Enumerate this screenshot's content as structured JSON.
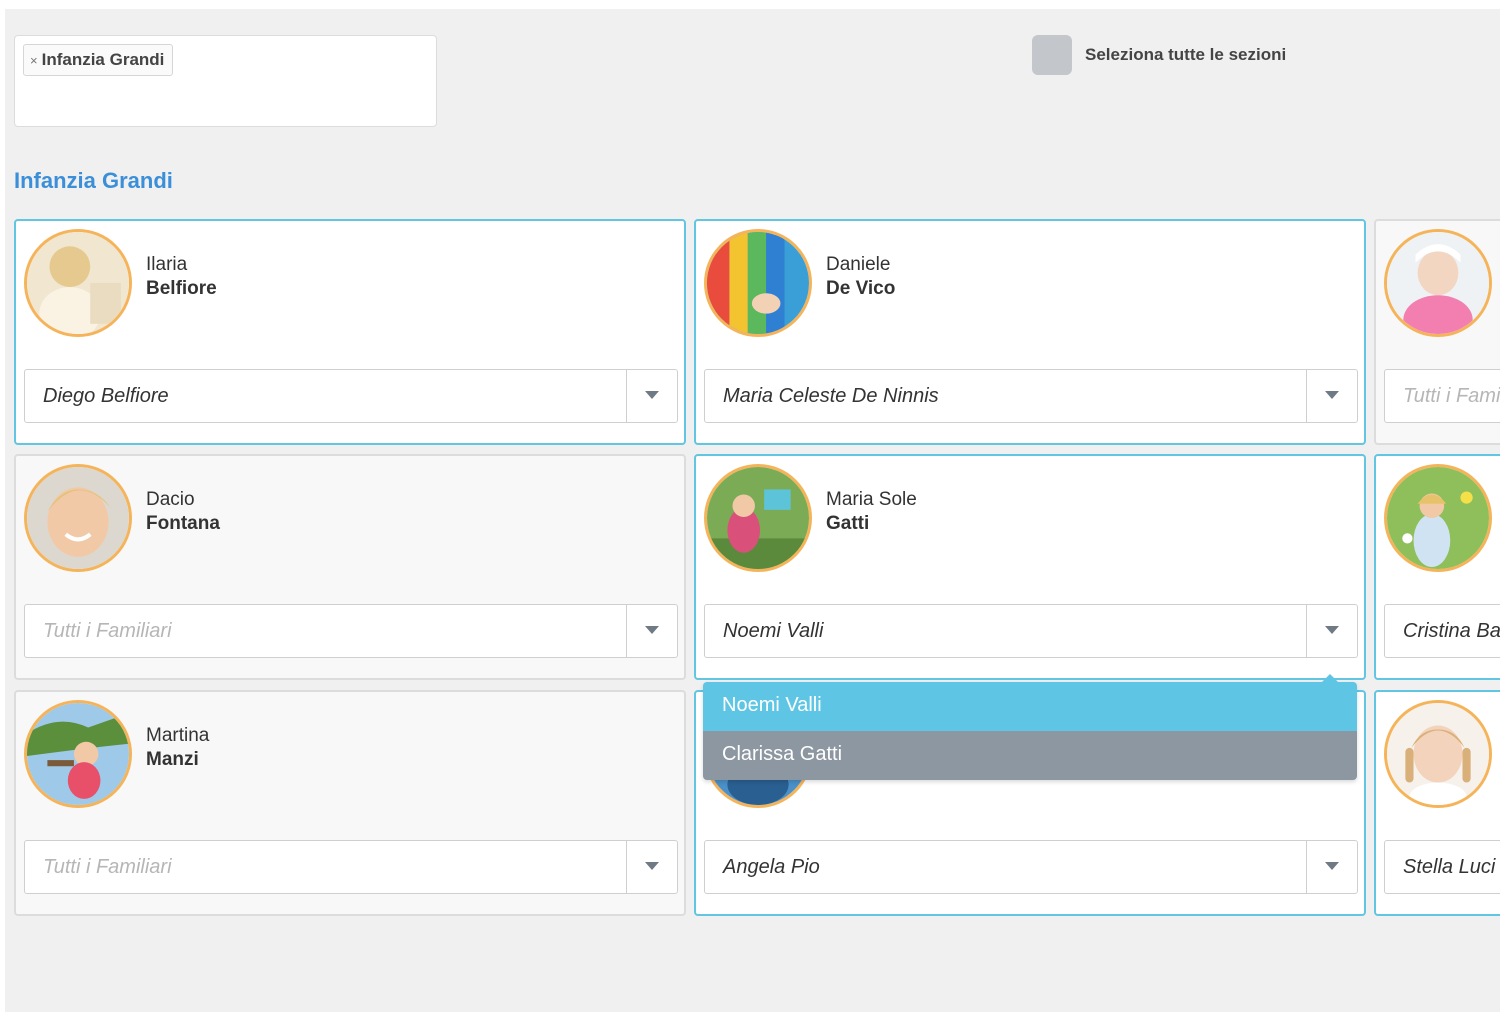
{
  "filter": {
    "remove_symbol": "×",
    "tag": "Infanzia Grandi"
  },
  "select_all_label": "Seleziona tutte le sezioni",
  "section_title": "Infanzia Grandi",
  "cards": [
    {
      "first": "Ilaria",
      "last": "Belfiore",
      "selected": "Diego Belfiore",
      "placeholder": false,
      "active": true
    },
    {
      "first": "Daniele",
      "last": "De Vico",
      "selected": "Maria Celeste De Ninnis",
      "placeholder": false,
      "active": true
    },
    {
      "first": "",
      "last": "",
      "selected": "Tutti i Familiari",
      "placeholder": true,
      "active": false
    },
    {
      "first": "Dacio",
      "last": "Fontana",
      "selected": "Tutti i Familiari",
      "placeholder": true,
      "active": false
    },
    {
      "first": "Maria Sole",
      "last": "Gatti",
      "selected": "Noemi Valli",
      "placeholder": false,
      "active": true
    },
    {
      "first": "",
      "last": "",
      "selected": "Cristina Ba",
      "placeholder": false,
      "active": true
    },
    {
      "first": "Martina",
      "last": "Manzi",
      "selected": "Tutti i Familiari",
      "placeholder": true,
      "active": false
    },
    {
      "first": "",
      "last": "",
      "selected": "Angela Pio",
      "placeholder": false,
      "active": true
    },
    {
      "first": "",
      "last": "",
      "selected": "Stella Luci",
      "placeholder": false,
      "active": true
    }
  ],
  "dropdown": {
    "options": [
      "Noemi Valli",
      "Clarissa Gatti"
    ],
    "selected_index": 0
  },
  "colors": {
    "accent": "#62c6e2",
    "title": "#3b8fd9",
    "avatar_ring": "#f5b45a",
    "dropdown_selected": "#5ec6e4",
    "dropdown_other": "#8c97a1"
  }
}
